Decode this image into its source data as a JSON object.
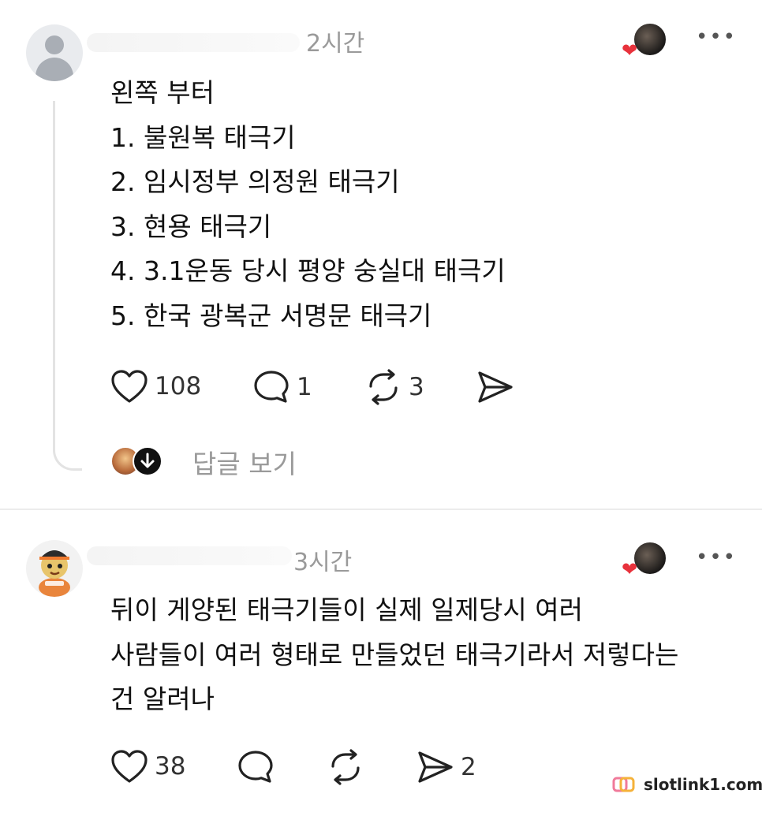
{
  "post1": {
    "time": "2시간",
    "lines": [
      "왼쪽 부터",
      "1. 불원복 태극기",
      "2. 임시정부 의정원 태극기",
      "3. 현용 태극기",
      "4. 3.1운동 당시 평양 숭실대 태극기",
      "5. 한국 광복군 서명문 태극기"
    ],
    "likes": "108",
    "comments": "1",
    "reposts": "3",
    "view_replies": "답글 보기"
  },
  "post2": {
    "time": "3시간",
    "lines": [
      "뒤이 게양된 태극기들이 실제 일제당시 여러",
      "사람들이 여러 형태로 만들었던 태극기라서 저렇다는",
      "건 알려나"
    ],
    "likes": "38",
    "shares": "2"
  },
  "icons": {
    "more": "more-icon",
    "like": "heart-icon",
    "comment": "comment-icon",
    "repost": "repost-icon",
    "share": "send-icon"
  },
  "colors": {
    "heart": "#e8323c",
    "muted": "#9a9a9a"
  },
  "watermark": "slotlink1.com"
}
